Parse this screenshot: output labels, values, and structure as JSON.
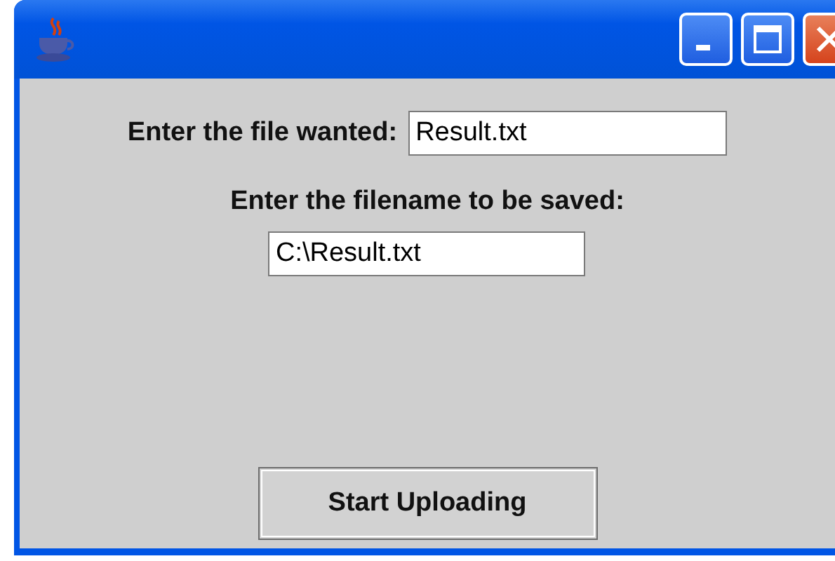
{
  "fields": [
    {
      "kind": "inline",
      "label": "Enter the file wanted:",
      "value": "Result.txt"
    },
    {
      "kind": "stacked",
      "label": "Enter the filename to be saved:",
      "value": "C:\\Result.txt"
    }
  ],
  "button": {
    "label": "Start Uploading"
  }
}
